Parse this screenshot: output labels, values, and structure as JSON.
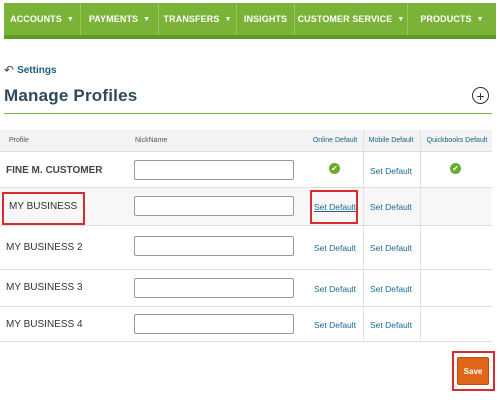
{
  "nav": {
    "items": [
      {
        "label": "ACCOUNTS",
        "dropdown": true
      },
      {
        "label": "PAYMENTS",
        "dropdown": true
      },
      {
        "label": "TRANSFERS",
        "dropdown": true
      },
      {
        "label": "INSIGHTS",
        "dropdown": false
      },
      {
        "label": "CUSTOMER SERVICE",
        "dropdown": true
      },
      {
        "label": "PRODUCTS",
        "dropdown": true
      }
    ],
    "caret": "▼"
  },
  "breadcrumb": {
    "back_icon": "↶",
    "label": "Settings"
  },
  "page": {
    "title": "Manage Profiles",
    "add_icon": "+"
  },
  "table": {
    "headers": {
      "profile": "Profile",
      "nickname": "NickName",
      "online_default": "Online Default",
      "mobile_default": "Mobile Default",
      "quickbooks_default": "Quickbooks Default"
    },
    "rows": [
      {
        "profile": "FINE M. CUSTOMER",
        "nickname": "",
        "online": "✔",
        "mobile": "Set Default",
        "quickbooks": "✔"
      },
      {
        "profile": "MY BUSINESS",
        "nickname": "",
        "online": "Set Default",
        "mobile": "Set Default",
        "quickbooks": ""
      },
      {
        "profile": "MY BUSINESS 2",
        "nickname": "",
        "online": "Set Default",
        "mobile": "Set Default",
        "quickbooks": ""
      },
      {
        "profile": "MY BUSINESS 3",
        "nickname": "",
        "online": "Set Default",
        "mobile": "Set Default",
        "quickbooks": ""
      },
      {
        "profile": "MY BUSINESS 4",
        "nickname": "",
        "online": "Set Default",
        "mobile": "Set Default",
        "quickbooks": ""
      }
    ]
  },
  "save_label": "Save",
  "colors": {
    "nav_green": "#7ab338",
    "link_blue": "#1b6a98",
    "save_orange": "#e0661a",
    "highlight_red": "#d92b2b",
    "check_green": "#6aab2c"
  }
}
